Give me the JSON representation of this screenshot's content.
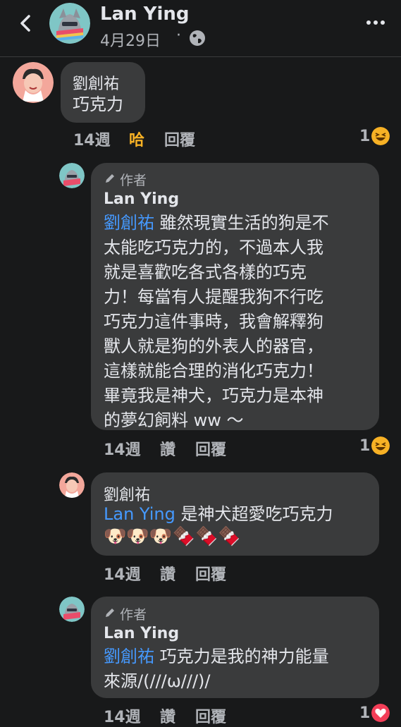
{
  "header": {
    "name": "Lan Ying",
    "date": "4月29日",
    "dot": "·",
    "icons": {
      "back": "chevron-left-icon",
      "privacy": "globe-icon",
      "more": "more-horizontal-icon"
    }
  },
  "comments": [
    {
      "author": "劉創祐",
      "text": "巧克力",
      "time": "14週",
      "reaction_action": "哈",
      "reply": "回覆",
      "reaction_count": "1",
      "reaction_type": "haha"
    },
    {
      "author_tag": "作者",
      "author": "Lan Ying",
      "mention": "劉創祐",
      "text_lines": [
        " 雖然現實生活的狗是不",
        "太能吃巧克力的，不過本人我",
        "就是喜歡吃各式各樣的巧克",
        "力！每當有人提醒我狗不行吃",
        "巧克力這件事時，我會解釋狗",
        "獸人就是狗的外表人的器官，",
        "這樣就能合理的消化巧克力！",
        "畢竟我是神犬，巧克力是本神",
        "的夢幻飼料 ww ～"
      ],
      "time": "14週",
      "like": "讚",
      "reply": "回覆",
      "reaction_count": "1",
      "reaction_type": "haha"
    },
    {
      "author": "劉創祐",
      "mention": "Lan Ying",
      "text": " 是神犬超愛吃巧克力",
      "emoji_line": "🐶🐶🐶🍫🍫🍫",
      "time": "14週",
      "like": "讚",
      "reply": "回覆"
    },
    {
      "author_tag": "作者",
      "author": "Lan Ying",
      "mention": "劉創祐",
      "text_line1": " 巧克力是我的神力能量",
      "text_line2": "來源/(///ω///)/",
      "time": "14週",
      "like": "讚",
      "reply": "回覆",
      "reaction_count": "1",
      "reaction_type": "love"
    }
  ],
  "colors": {
    "background": "#18191a",
    "bubble": "#3a3b3c",
    "mention": "#4599ff",
    "haha": "#f7b125",
    "love": "#f33e58"
  }
}
